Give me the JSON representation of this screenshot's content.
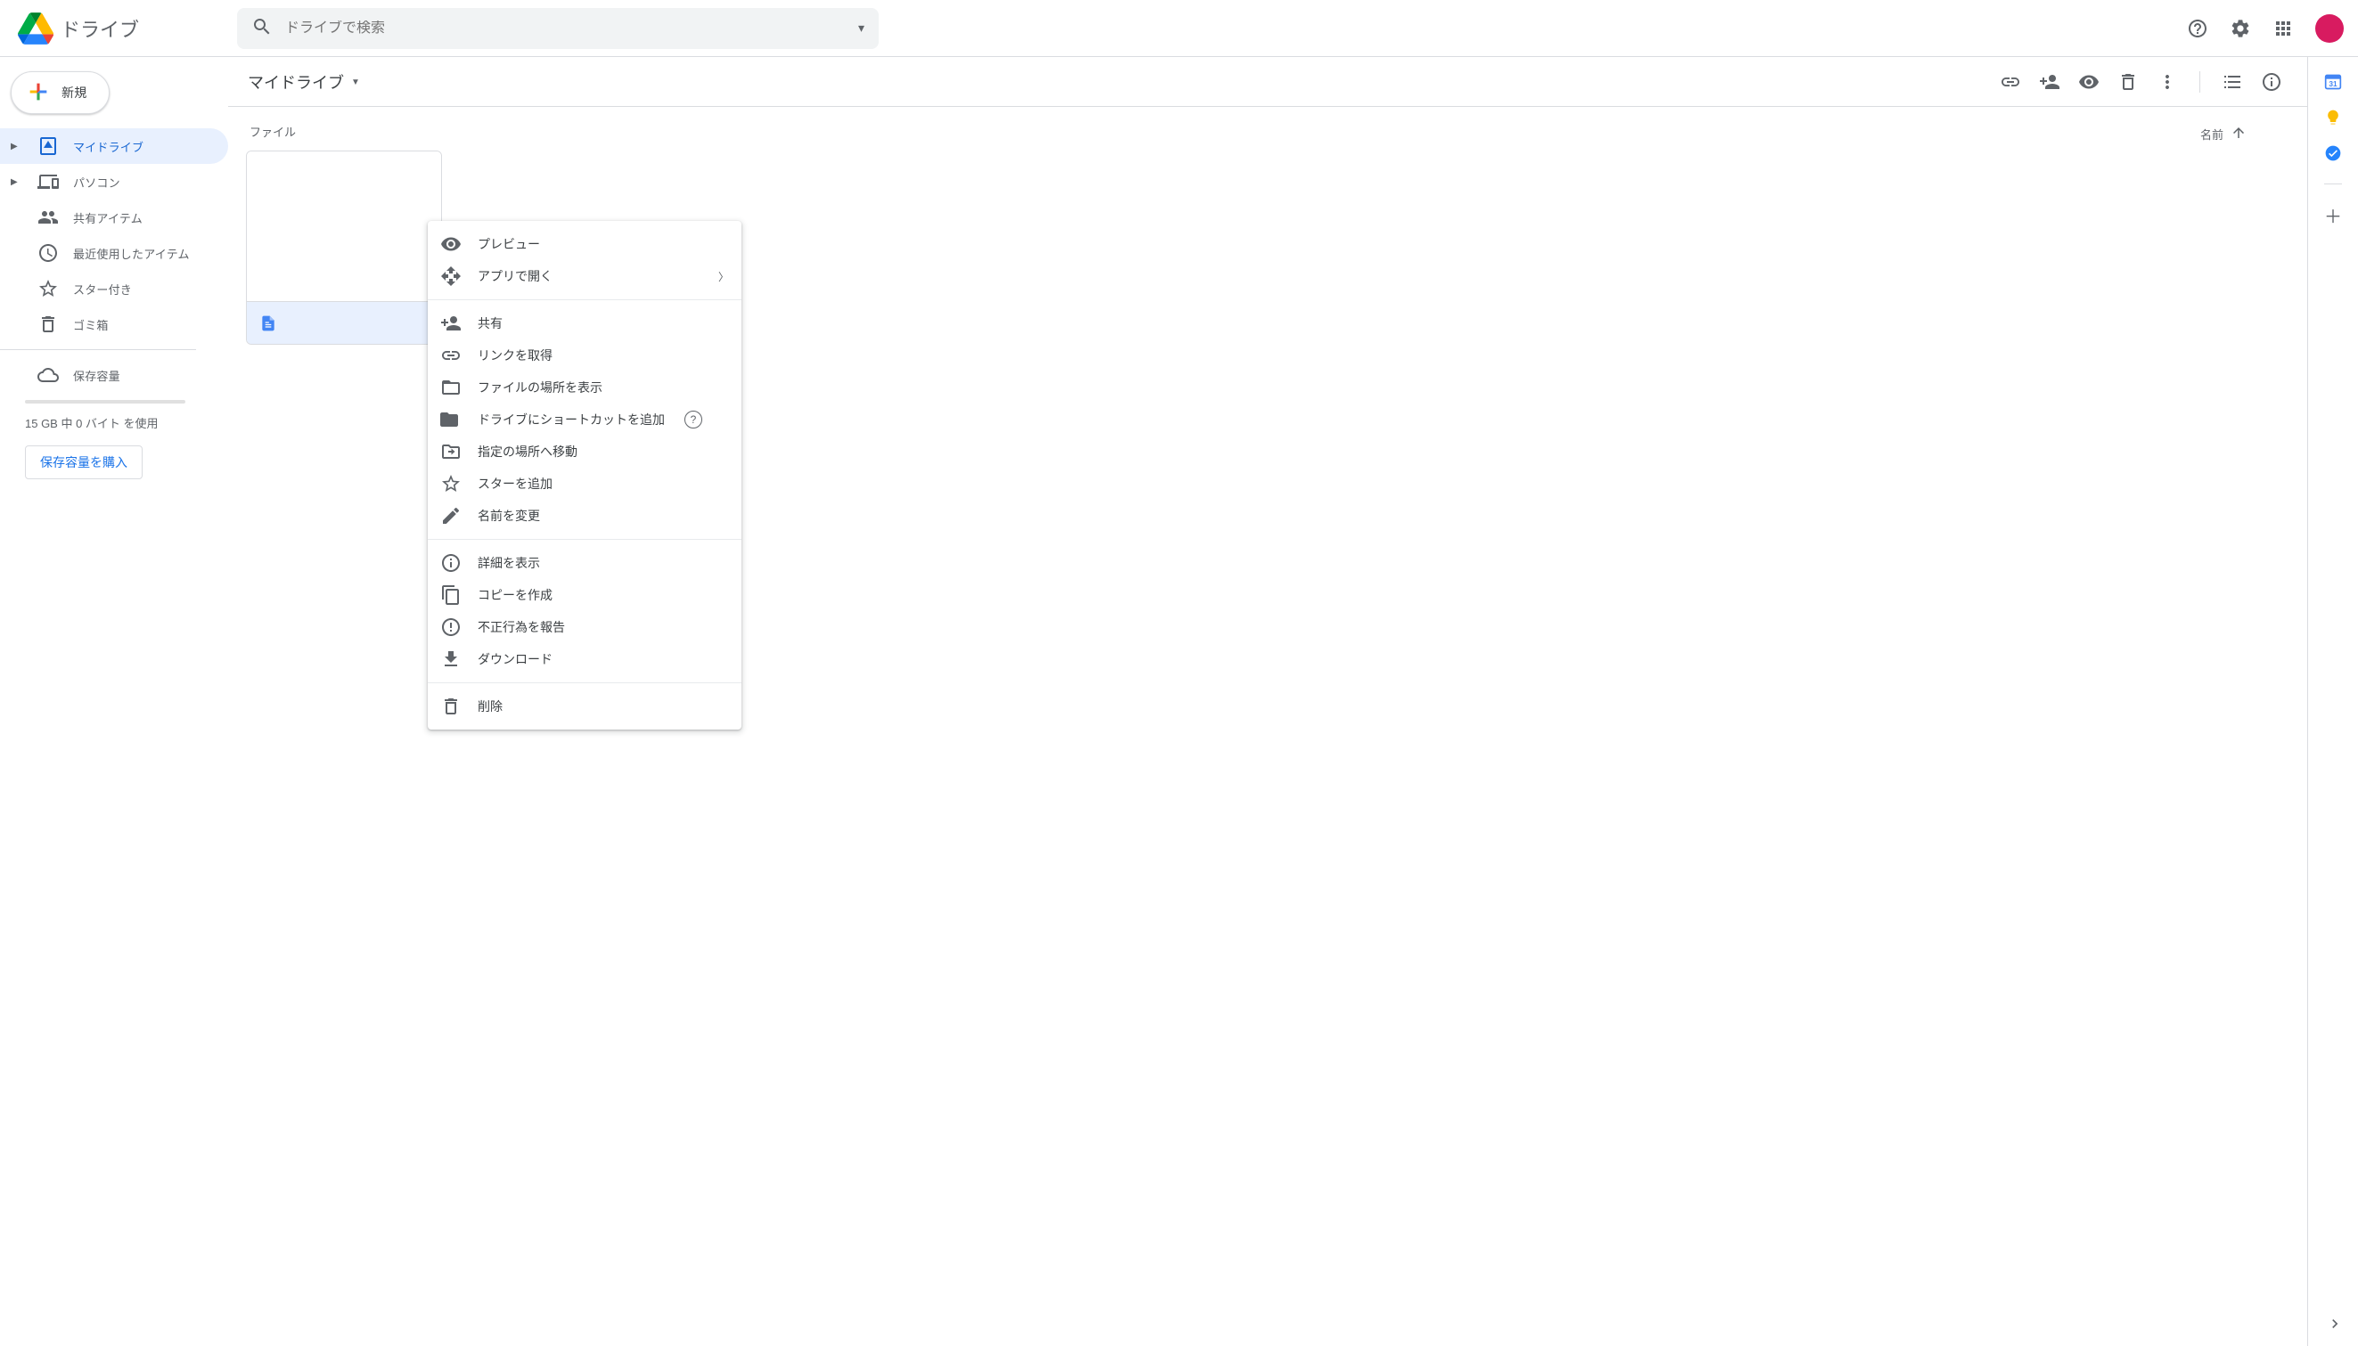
{
  "app_name": "ドライブ",
  "search_placeholder": "ドライブで検索",
  "new_button": "新規",
  "nav": [
    {
      "label": "マイドライブ",
      "icon": "drive",
      "expandable": true,
      "active": true
    },
    {
      "label": "パソコン",
      "icon": "devices",
      "expandable": true
    },
    {
      "label": "共有アイテム",
      "icon": "shared"
    },
    {
      "label": "最近使用したアイテム",
      "icon": "clock"
    },
    {
      "label": "スター付き",
      "icon": "star"
    },
    {
      "label": "ゴミ箱",
      "icon": "trash"
    }
  ],
  "storage": {
    "label": "保存容量",
    "usage_text": "15 GB 中 0 バイト を使用",
    "buy_label": "保存容量を購入"
  },
  "breadcrumb": "マイドライブ",
  "section_title": "ファイル",
  "sort": {
    "label": "名前",
    "direction": "asc"
  },
  "file": {
    "name": ""
  },
  "context_menu": [
    {
      "label": "プレビュー",
      "icon": "eye"
    },
    {
      "label": "アプリで開く",
      "icon": "openwith",
      "submenu": true
    },
    {
      "divider": true
    },
    {
      "label": "共有",
      "icon": "personadd"
    },
    {
      "label": "リンクを取得",
      "icon": "link"
    },
    {
      "label": "ファイルの場所を表示",
      "icon": "folder"
    },
    {
      "label": "ドライブにショートカットを追加",
      "icon": "shortcut",
      "help": true
    },
    {
      "label": "指定の場所へ移動",
      "icon": "moveto"
    },
    {
      "label": "スターを追加",
      "icon": "star"
    },
    {
      "label": "名前を変更",
      "icon": "rename"
    },
    {
      "divider": true
    },
    {
      "label": "詳細を表示",
      "icon": "info"
    },
    {
      "label": "コピーを作成",
      "icon": "copy"
    },
    {
      "label": "不正行為を報告",
      "icon": "report"
    },
    {
      "label": "ダウンロード",
      "icon": "download"
    },
    {
      "divider": true
    },
    {
      "label": "削除",
      "icon": "trash"
    }
  ],
  "side_panel": [
    "calendar",
    "keep",
    "tasks"
  ],
  "side_panel_calendar_day": "31"
}
